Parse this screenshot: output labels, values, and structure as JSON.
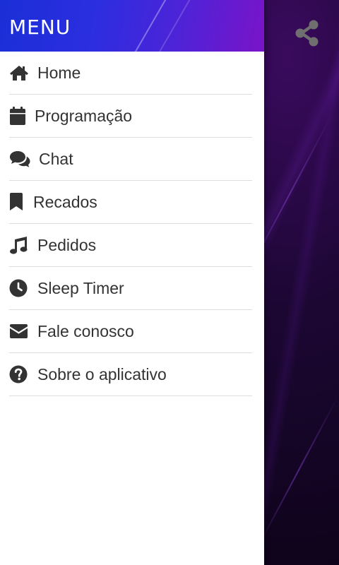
{
  "drawer": {
    "title": "MENU",
    "items": [
      {
        "label": "Home",
        "icon": "home-icon"
      },
      {
        "label": "Programação",
        "icon": "calendar-icon"
      },
      {
        "label": "Chat",
        "icon": "chat-icon"
      },
      {
        "label": "Recados",
        "icon": "bookmark-icon"
      },
      {
        "label": "Pedidos",
        "icon": "music-note-icon"
      },
      {
        "label": "Sleep Timer",
        "icon": "clock-icon"
      },
      {
        "label": "Fale conosco",
        "icon": "envelope-icon"
      },
      {
        "label": "Sobre o aplicativo",
        "icon": "question-circle-icon"
      }
    ]
  },
  "topbar": {
    "share_icon": "share-icon"
  },
  "colors": {
    "header_start": "#1b2fd6",
    "header_end": "#7a14c9",
    "icon": "#333333",
    "text": "#333333",
    "divider": "#dedede",
    "background": "#12041f"
  }
}
